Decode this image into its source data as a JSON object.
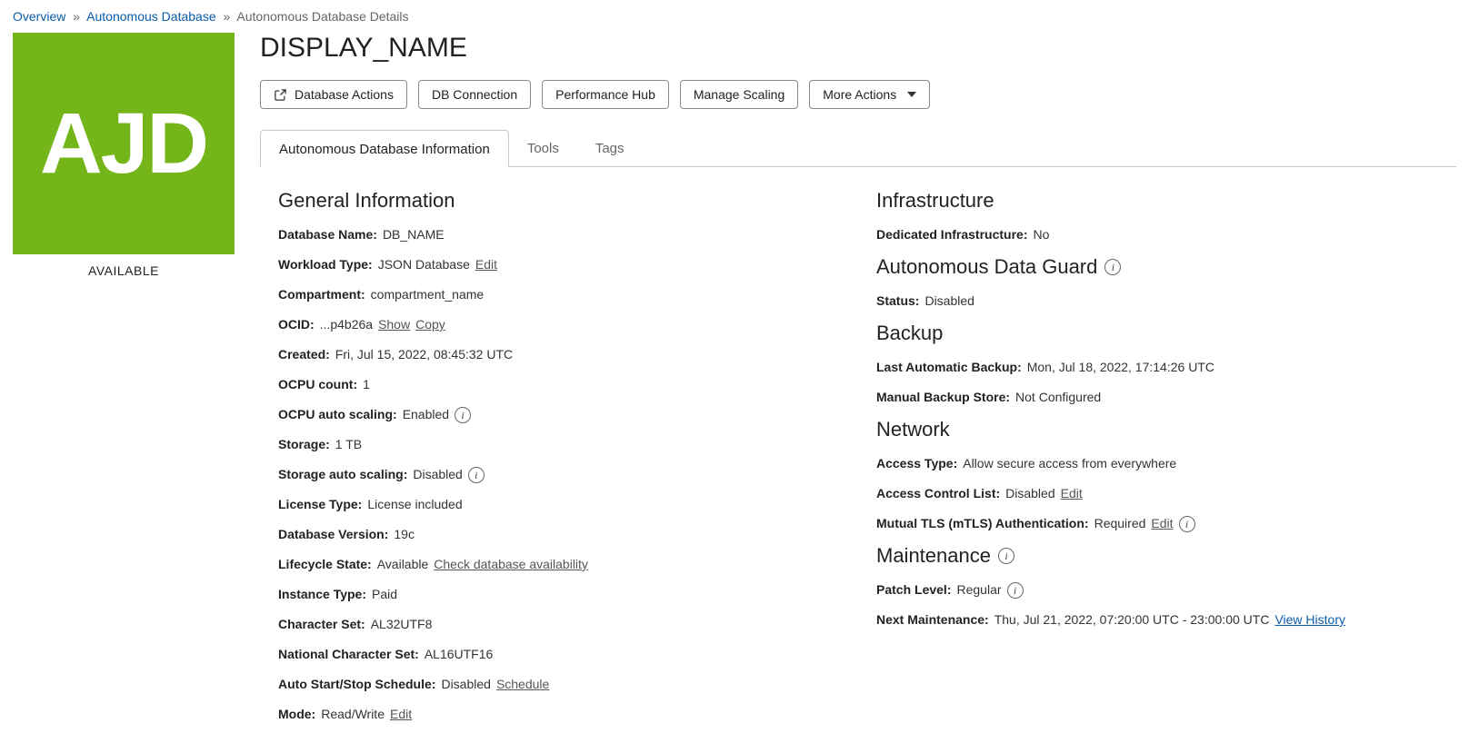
{
  "breadcrumbs": {
    "items": [
      {
        "label": "Overview",
        "link": true
      },
      {
        "label": "Autonomous Database",
        "link": true
      },
      {
        "label": "Autonomous Database Details",
        "link": false
      }
    ]
  },
  "left": {
    "badge": "AJD",
    "status": "AVAILABLE"
  },
  "header": {
    "title": "DISPLAY_NAME"
  },
  "buttons": {
    "db_actions": "Database Actions",
    "db_connection": "DB Connection",
    "perf_hub": "Performance Hub",
    "manage_scaling": "Manage Scaling",
    "more_actions": "More Actions"
  },
  "tabs": [
    {
      "id": "info",
      "label": "Autonomous Database Information",
      "active": true
    },
    {
      "id": "tools",
      "label": "Tools",
      "active": false
    },
    {
      "id": "tags",
      "label": "Tags",
      "active": false
    }
  ],
  "general": {
    "heading": "General Information",
    "fields": {
      "database_name": {
        "label": "Database Name:",
        "value": "DB_NAME"
      },
      "workload_type": {
        "label": "Workload Type:",
        "value": "JSON Database",
        "edit": "Edit"
      },
      "compartment": {
        "label": "Compartment:",
        "value": "compartment_name"
      },
      "ocid": {
        "label": "OCID:",
        "value": "...p4b26a",
        "show": "Show",
        "copy": "Copy"
      },
      "created": {
        "label": "Created:",
        "value": "Fri, Jul 15, 2022, 08:45:32 UTC"
      },
      "ocpu_count": {
        "label": "OCPU count:",
        "value": "1"
      },
      "ocpu_auto": {
        "label": "OCPU auto scaling:",
        "value": "Enabled"
      },
      "storage": {
        "label": "Storage:",
        "value": "1 TB"
      },
      "storage_auto": {
        "label": "Storage auto scaling:",
        "value": "Disabled"
      },
      "license": {
        "label": "License Type:",
        "value": "License included"
      },
      "db_version": {
        "label": "Database Version:",
        "value": "19c"
      },
      "lifecycle": {
        "label": "Lifecycle State:",
        "value": "Available",
        "check": "Check database availability"
      },
      "instance_type": {
        "label": "Instance Type:",
        "value": "Paid"
      },
      "charset": {
        "label": "Character Set:",
        "value": "AL32UTF8"
      },
      "ncharset": {
        "label": "National Character Set:",
        "value": "AL16UTF16"
      },
      "auto_schedule": {
        "label": "Auto Start/Stop Schedule:",
        "value": "Disabled",
        "schedule": "Schedule"
      },
      "mode": {
        "label": "Mode:",
        "value": "Read/Write",
        "edit": "Edit"
      }
    }
  },
  "infrastructure": {
    "heading": "Infrastructure",
    "dedicated": {
      "label": "Dedicated Infrastructure:",
      "value": "No"
    }
  },
  "data_guard": {
    "heading": "Autonomous Data Guard",
    "status": {
      "label": "Status:",
      "value": "Disabled"
    }
  },
  "backup": {
    "heading": "Backup",
    "last_auto": {
      "label": "Last Automatic Backup:",
      "value": "Mon, Jul 18, 2022, 17:14:26 UTC"
    },
    "manual": {
      "label": "Manual Backup Store:",
      "value": "Not Configured"
    }
  },
  "network": {
    "heading": "Network",
    "access_type": {
      "label": "Access Type:",
      "value": "Allow secure access from everywhere"
    },
    "acl": {
      "label": "Access Control List:",
      "value": "Disabled",
      "edit": "Edit"
    },
    "mtls": {
      "label": "Mutual TLS (mTLS) Authentication:",
      "value": "Required",
      "edit": "Edit"
    }
  },
  "maintenance": {
    "heading": "Maintenance",
    "patch_level": {
      "label": "Patch Level:",
      "value": "Regular"
    },
    "next": {
      "label": "Next Maintenance:",
      "value": "Thu, Jul 21, 2022, 07:20:00 UTC - 23:00:00 UTC",
      "view": "View History"
    }
  }
}
